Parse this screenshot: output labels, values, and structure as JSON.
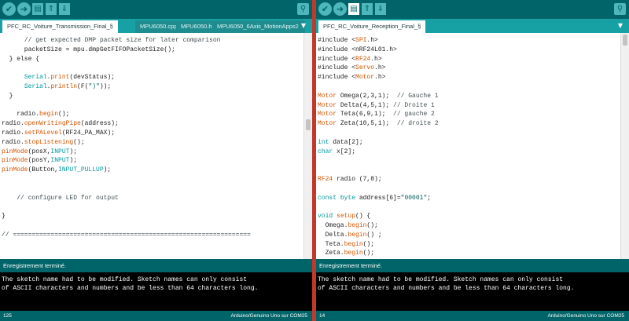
{
  "left": {
    "toolbar": {
      "verify_icon": "✔",
      "upload_icon": "➜",
      "new_icon": "▤",
      "open_icon": "⇑",
      "save_icon": "⇓",
      "serial_icon": "⚲"
    },
    "tabs": [
      {
        "label": "PFC_RC_Voiture_Transmission_Final_§"
      },
      {
        "label": "MPU6050.cpp"
      },
      {
        "label": "MPU6050.h"
      },
      {
        "label": "MPU6050_6Axis_MotionApps2"
      }
    ],
    "tab_menu_icon": "▼",
    "code_lines": [
      {
        "html": "      <span class=\"cmt\">// get expected DMP packet size for later comparison</span>"
      },
      {
        "html": "      packetSize = mpu.dmpGetFIFOPacketSize();"
      },
      {
        "html": "  } else {"
      },
      {
        "html": ""
      },
      {
        "html": "      <span class=\"kw-type\">Serial</span>.<span class=\"kw-fn\">print</span>(devStatus);"
      },
      {
        "html": "      <span class=\"kw-type\">Serial</span>.<span class=\"kw-fn\">println</span>(F(<span class=\"str\">\")\"</span>));"
      },
      {
        "html": "  }"
      },
      {
        "html": ""
      },
      {
        "html": "    radio.<span class=\"kw-fn\">begin</span>();"
      },
      {
        "html": "radio.<span class=\"kw-fn\">openWritingPipe</span>(address);"
      },
      {
        "html": "radio.<span class=\"kw-fn\">setPALevel</span>(RF24_PA_MAX);"
      },
      {
        "html": "radio.<span class=\"kw-fn\">stopListening</span>();"
      },
      {
        "html": "<span class=\"kw-fn\">pinMode</span>(posX,<span class=\"kw-lit\">INPUT</span>);"
      },
      {
        "html": "<span class=\"kw-fn\">pinMode</span>(posY,<span class=\"kw-lit\">INPUT</span>);"
      },
      {
        "html": "<span class=\"kw-fn\">pinMode</span>(Button,<span class=\"kw-lit\">INPUT_PULLUP</span>);"
      },
      {
        "html": ""
      },
      {
        "html": ""
      },
      {
        "html": "    <span class=\"cmt\">// configure LED for output</span>"
      },
      {
        "html": ""
      },
      {
        "html": "}"
      },
      {
        "html": ""
      },
      {
        "html": "<span class=\"cmt\">// ===============================================================</span>"
      }
    ],
    "status": "Enregistrement terminé.",
    "console_lines": [
      "The sketch name had to be modified. Sketch names can only consist",
      "of ASCII characters and numbers and be less than 64 characters long."
    ],
    "footer": {
      "line": "125",
      "board": "Arduino/Genuino Uno sur COM25"
    }
  },
  "right": {
    "toolbar": {
      "verify_icon": "✔",
      "upload_icon": "➜",
      "new_icon": "▤",
      "open_icon": "⇑",
      "save_icon": "⇓",
      "serial_icon": "⚲"
    },
    "tabs": [
      {
        "label": "PFC_RC_Voiture_Reception_Final_§"
      }
    ],
    "tab_menu_icon": "▼",
    "code_lines": [
      {
        "html": "#include &lt;<span class=\"kw-fn\">SPI</span>.h&gt;"
      },
      {
        "html": "#include &lt;nRF24L01.h&gt;"
      },
      {
        "html": "#include &lt;<span class=\"kw-fn\">RF24</span>.h&gt;"
      },
      {
        "html": "#include &lt;<span class=\"kw-fn\">Servo</span>.h&gt;"
      },
      {
        "html": "#include &lt;<span class=\"kw-fn\">Motor</span>.h&gt;"
      },
      {
        "html": ""
      },
      {
        "html": "<span class=\"kw-fn\">Motor</span> Omega(2,3,1);  <span class=\"cmt\">// Gauche 1</span>"
      },
      {
        "html": "<span class=\"kw-fn\">Motor</span> Delta(4,5,1); <span class=\"cmt\">// Droite 1</span>"
      },
      {
        "html": "<span class=\"kw-fn\">Motor</span> Teta(6,9,1);  <span class=\"cmt\">// gauche 2</span>"
      },
      {
        "html": "<span class=\"kw-fn\">Motor</span> Zeta(10,5,1);  <span class=\"cmt\">// droite 2</span>"
      },
      {
        "html": ""
      },
      {
        "html": "<span class=\"kw-type\">int</span> data[2];"
      },
      {
        "html": "<span class=\"kw-type\">char</span> x[2];"
      },
      {
        "html": ""
      },
      {
        "html": ""
      },
      {
        "html": "<span class=\"kw-fn\">RF24</span> radio (7,8);"
      },
      {
        "html": ""
      },
      {
        "html": "<span class=\"kw-type\">const</span> <span class=\"kw-type\">byte</span> address[6]=<span class=\"str\">\"00001\"</span>;"
      },
      {
        "html": ""
      },
      {
        "html": "<span class=\"kw-type\">void</span> <span class=\"kw-fn\">setup</span>() {"
      },
      {
        "html": "  Omega.<span class=\"kw-fn\">begin</span>();"
      },
      {
        "html": "  Delta.<span class=\"kw-fn\">begin</span>() ;"
      },
      {
        "html": "  Teta.<span class=\"kw-fn\">begin</span>();"
      },
      {
        "html": "  Zeta.<span class=\"kw-fn\">begin</span>();"
      }
    ],
    "status": "Enregistrement terminé.",
    "console_lines": [
      "The sketch name had to be modified. Sketch names can only consist",
      "of ASCII characters and numbers and be less than 64 characters long."
    ],
    "footer": {
      "line": "14",
      "board": "Arduino/Genuino Uno sur COM25"
    }
  }
}
